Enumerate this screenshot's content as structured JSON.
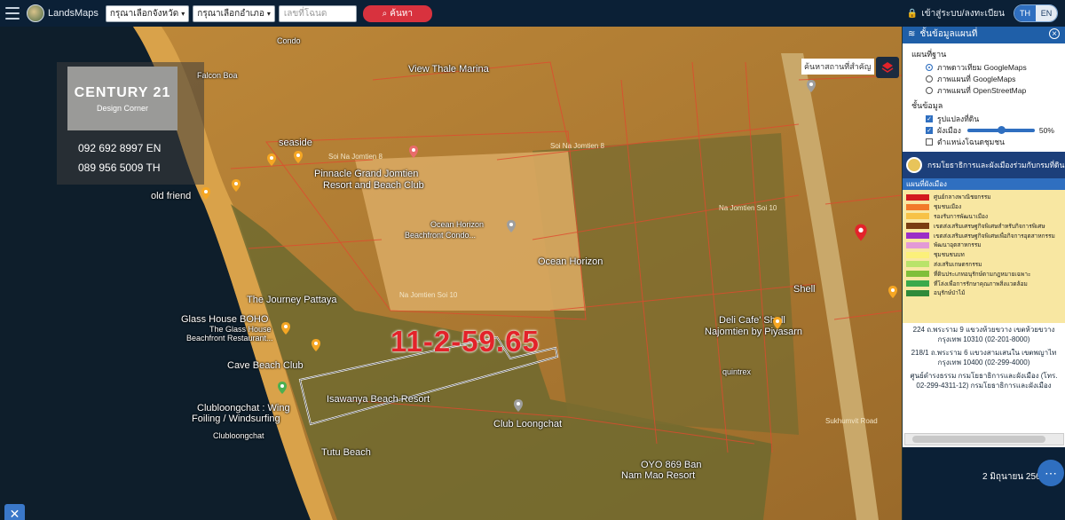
{
  "topbar": {
    "brand": "LandsMaps",
    "province_select": "กรุณาเลือกจังหวัด",
    "district_select": "กรุณาเลือกอำเภอ",
    "parcel_placeholder": "เลขที่โฉนด",
    "search_button": "ค้นหา",
    "login_label": "เข้าสู่ระบบ/ลงทะเบียน",
    "lang_th": "TH",
    "lang_en": "EN"
  },
  "watermark": {
    "title": "CENTURY 21",
    "subtitle": "Design Corner",
    "phone_en": "092 692 8997 EN",
    "phone_th": "089 956 5009 TH"
  },
  "map": {
    "parcel_code": "11-2-59.65",
    "find_place_placeholder": "ค้นหาสถานที่สำคัญ",
    "labels": [
      {
        "text": "Condo",
        "cls": "small"
      },
      {
        "text": "Falcon Boa",
        "cls": "small"
      },
      {
        "text": "View Thale Marina",
        "cls": ""
      },
      {
        "text": "seaside",
        "cls": ""
      },
      {
        "text": "Pinnacle Grand Jomtien",
        "cls": ""
      },
      {
        "text": "Resort and Beach Club",
        "cls": ""
      },
      {
        "text": "old friend",
        "cls": ""
      },
      {
        "text": "Ocean Horizon",
        "cls": "small"
      },
      {
        "text": "Beachfront Condo...",
        "cls": "small"
      },
      {
        "text": "Ocean Horizon",
        "cls": ""
      },
      {
        "text": "The Journey Pattaya",
        "cls": ""
      },
      {
        "text": "Glass House BOHO",
        "cls": ""
      },
      {
        "text": "The Glass House",
        "cls": "small"
      },
      {
        "text": "Beachfront Restaurant...",
        "cls": "small"
      },
      {
        "text": "Cave Beach Club",
        "cls": ""
      },
      {
        "text": "Clubloongchat : Wing",
        "cls": ""
      },
      {
        "text": "Foiling / Windsurfing",
        "cls": ""
      },
      {
        "text": "Clubloongchat",
        "cls": "small"
      },
      {
        "text": "Isawanya Beach Resort",
        "cls": ""
      },
      {
        "text": "Club Loongchat",
        "cls": ""
      },
      {
        "text": "Tutu Beach",
        "cls": ""
      },
      {
        "text": "Deli Cafe' Shell",
        "cls": ""
      },
      {
        "text": "Najomtien by Piyasarn",
        "cls": ""
      },
      {
        "text": "quintrex",
        "cls": "small"
      },
      {
        "text": "Shell",
        "cls": ""
      },
      {
        "text": "OYO 869 Ban",
        "cls": ""
      },
      {
        "text": "Nam Mao Resort",
        "cls": ""
      },
      {
        "text": "Soi Na Jomtien 8",
        "cls": "street"
      },
      {
        "text": "Soi Na Jomtien 8",
        "cls": "street"
      },
      {
        "text": "Na Jomtien Soi 10",
        "cls": "street"
      },
      {
        "text": "Na Jomtien Soi 10",
        "cls": "street"
      },
      {
        "text": "Sukhumvit Road",
        "cls": "street"
      }
    ]
  },
  "panel": {
    "title": "ชั้นข้อมูลแผนที่",
    "base_title": "แผนที่ฐาน",
    "base_options": [
      {
        "label": "ภาพดาวเทียม GoogleMaps",
        "on": true
      },
      {
        "label": "ภาพแผนที่ GoogleMaps",
        "on": false
      },
      {
        "label": "ภาพแผนที่ OpenStreetMap",
        "on": false
      }
    ],
    "layers_title": "ชั้นข้อมูล",
    "layer_options": [
      {
        "label": "รูปแปลงที่ดิน",
        "on": true
      },
      {
        "label": "ผังเมือง",
        "on": true
      },
      {
        "label": "ตำแหน่งโฉนดชุมชน",
        "on": false
      }
    ],
    "opacity": 0.5,
    "opacity_label": "50%",
    "banner_text": "กรมโยธาธิการและผังเมืองร่วมกับกรมที่ดิน",
    "legend_title": "แผนที่ผังเมือง",
    "legend": [
      {
        "label": "ศูนย์กลางพาณิชยกรรม",
        "color": "#d3191f"
      },
      {
        "label": "ชุมชนเมือง",
        "color": "#f27a2a"
      },
      {
        "label": "รองรับการพัฒนาเมือง",
        "color": "#f7c246"
      },
      {
        "label": "เขตส่งเสริมเศรษฐกิจพิเศษสำหรับกิจการพิเศษ",
        "color": "#7a3e12"
      },
      {
        "label": "เขตส่งเสริมเศรษฐกิจพิเศษเพื่อกิจการอุตสาหกรรม",
        "color": "#9b2fc7"
      },
      {
        "label": "พัฒนาอุตสาหกรรม",
        "color": "#e39ad6"
      },
      {
        "label": "ชุมชนชนบท",
        "color": "#fbf07a"
      },
      {
        "label": "ส่งเสริมเกษตรกรรม",
        "color": "#b9e36a"
      },
      {
        "label": "ที่ดินประเภทอนุรักษ์ตามกฎหมายเฉพาะ",
        "color": "#7fbf3a"
      },
      {
        "label": "ที่โล่งเพื่อการรักษาคุณภาพสิ่งแวดล้อม",
        "color": "#3aa94b"
      },
      {
        "label": "อนุรักษ์ป่าไม้",
        "color": "#2f8a3a"
      }
    ],
    "contacts": [
      "224 ถ.พระราม 9 แขวงห้วยขวาง เขตห้วยขวาง กรุงเทพ 10310 (02-201-8000)",
      "218/1 ถ.พระราม 6 แขวงสามเสนใน เขตพญาไท กรุงเทพ 10400 (02-299-4000)",
      "ศูนย์ดำรงธรรม กรมโยธาธิการและผังเมือง (โทร. 02-299-4311-12) กรมโยธาธิการและผังเมือง"
    ],
    "date": "2 มิถุนายน 2566"
  },
  "colors": {
    "topbar": "#0b2036",
    "accent": "#2f6fc0",
    "search_btn": "#d8323e",
    "parcel_code": "#e3232a"
  }
}
